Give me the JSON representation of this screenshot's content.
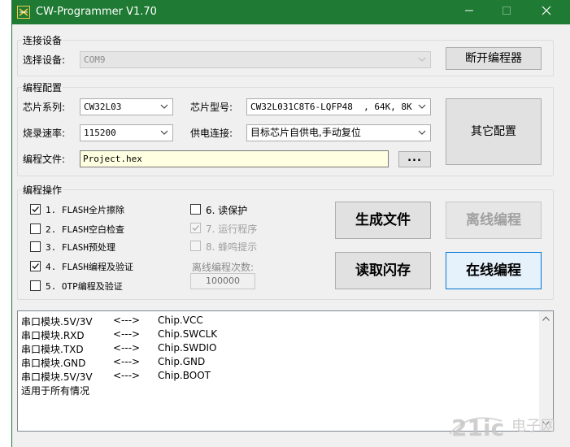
{
  "window": {
    "title": "CW-Programmer V1.70"
  },
  "connect": {
    "group_label": "连接设备",
    "device_label": "选择设备:",
    "device_value": "COM9",
    "disconnect_button": "断开编程器"
  },
  "config": {
    "group_label": "编程配置",
    "chip_series_label": "芯片系列:",
    "chip_series_value": "CW32L03",
    "chip_model_label": "芯片型号:",
    "chip_model_value": "CW32L031C8T6-LQFP48  , 64K, 8K",
    "baud_label": "烧录速率:",
    "baud_value": "115200",
    "power_label": "供电连接:",
    "power_value": "目标芯片自供电,手动复位",
    "file_label": "编程文件:",
    "file_value": "Project.hex",
    "browse_button": "...",
    "other_config_button": "其它配置"
  },
  "ops": {
    "group_label": "编程操作",
    "options": [
      {
        "label": "1. FLASH全片擦除",
        "checked": true,
        "disabled": false
      },
      {
        "label": "2. FLASH空白检查",
        "checked": false,
        "disabled": false
      },
      {
        "label": "3. FLASH预处理",
        "checked": false,
        "disabled": false
      },
      {
        "label": "4. FLASH编程及验证",
        "checked": true,
        "disabled": false
      },
      {
        "label": "5. OTP编程及验证",
        "checked": false,
        "disabled": false
      },
      {
        "label": "6. 读保护",
        "checked": false,
        "disabled": false
      },
      {
        "label": "7. 运行程序",
        "checked": true,
        "disabled": true
      },
      {
        "label": "8. 蜂鸣提示",
        "checked": false,
        "disabled": true
      }
    ],
    "offline_count_label": "离线编程次数:",
    "offline_count_value": "100000",
    "generate_button": "生成文件",
    "offline_button": "离线编程",
    "read_button": "读取闪存",
    "online_button": "在线编程"
  },
  "log": {
    "rows": [
      {
        "a": "串口模块.5V/3V",
        "arrow": "<--->",
        "b": "Chip.VCC"
      },
      {
        "a": "串口模块.RXD",
        "arrow": "<--->",
        "b": "Chip.SWCLK"
      },
      {
        "a": "串口模块.TXD",
        "arrow": "<--->",
        "b": "Chip.SWDIO"
      },
      {
        "a": "串口模块.GND",
        "arrow": "<--->",
        "b": "Chip.GND"
      },
      {
        "a": "串口模块.5V/3V",
        "arrow": "<--->",
        "b": "Chip.BOOT"
      }
    ],
    "footer": "适用于所有情况"
  },
  "watermark": {
    "text": "21ic",
    "text2": "电子网"
  },
  "colors": {
    "titlebar": "#1f7a33",
    "input_bg": "#ffffe1",
    "focus": "#0078d7"
  }
}
